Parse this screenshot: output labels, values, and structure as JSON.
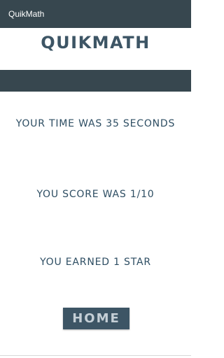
{
  "appbar": {
    "title": "QuikMath"
  },
  "header": {
    "brand": "QUIKMATH"
  },
  "results": {
    "time_text": "YOUR TIME WAS 35 SECONDS",
    "score_text": "YOU SCORE WAS 1/10",
    "stars_text": "YOU EARNED 1 STAR"
  },
  "actions": {
    "home_label": "HOME"
  },
  "colors": {
    "appbar": "#37474f",
    "text": "#2e4e63",
    "button_bg": "#3d5565",
    "button_text": "#c5cfd6"
  }
}
